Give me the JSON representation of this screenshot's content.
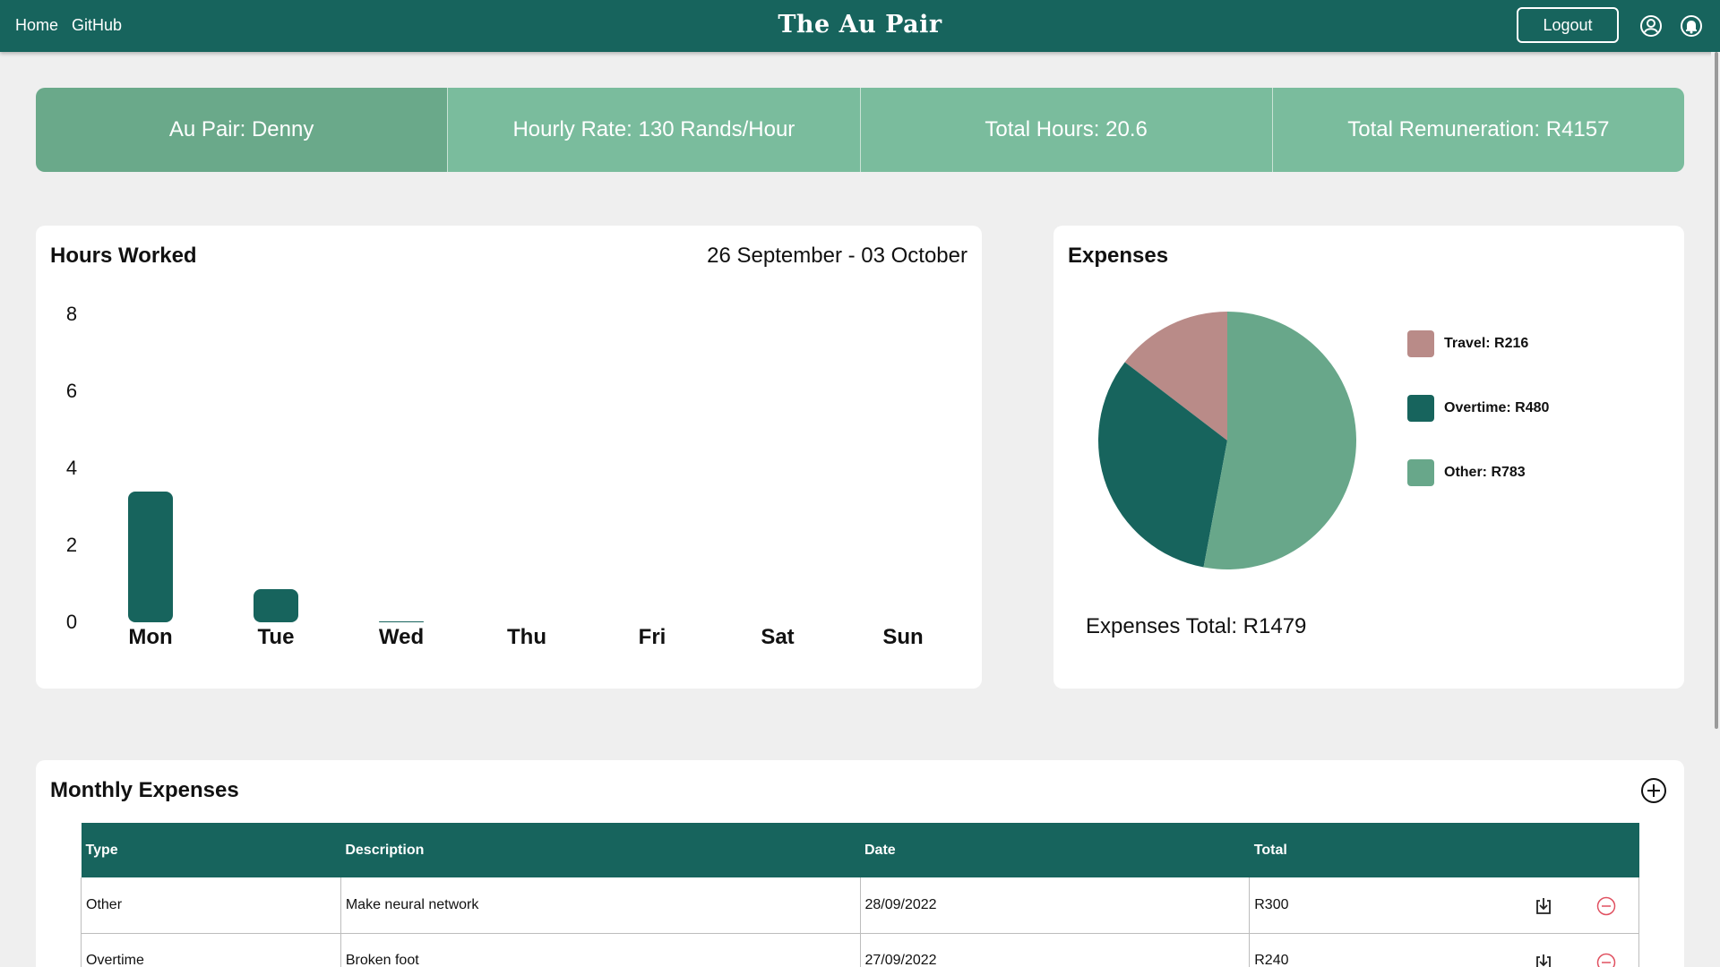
{
  "nav": {
    "home": "Home",
    "github": "GitHub",
    "brand": "The Au Pair",
    "logout": "Logout",
    "profile_icon": "user-circle-icon",
    "bell_icon": "notification-bell-icon"
  },
  "stats": {
    "au_pair": "Au Pair: Denny",
    "hourly_rate": "Hourly Rate: 130 Rands/Hour",
    "total_hours": "Total Hours: 20.6",
    "total_remuneration": "Total Remuneration: R4157"
  },
  "hours_card": {
    "title": "Hours Worked",
    "range": "26 September - 03 October"
  },
  "expenses_card": {
    "title": "Expenses",
    "total": "Expenses Total: R1479"
  },
  "chart_data": [
    {
      "type": "bar",
      "title": "Hours Worked",
      "categories": [
        "Mon",
        "Tue",
        "Wed",
        "Thu",
        "Fri",
        "Sat",
        "Sun"
      ],
      "values": [
        3.4,
        0.85,
        0.03,
        0,
        0,
        0,
        0
      ],
      "yticks": [
        "0",
        "2",
        "4",
        "6",
        "8"
      ],
      "ylim": [
        0,
        8
      ],
      "grid": false,
      "bar_color": "#17645d"
    },
    {
      "type": "pie",
      "title": "Expenses",
      "labels": [
        "Travel: R216",
        "Overtime: R480",
        "Other: R783"
      ],
      "values": [
        216,
        480,
        783
      ],
      "colors": [
        "#b98b88",
        "#17645d",
        "#68a78a"
      ],
      "legend": "right"
    }
  ],
  "monthly": {
    "title": "Monthly Expenses",
    "add_icon": "plus-circle-icon",
    "columns": [
      "Type",
      "Description",
      "Date",
      "Total"
    ],
    "rows": [
      {
        "type": "Other",
        "description": "Make neural network",
        "date": "28/09/2022",
        "total": "R300"
      },
      {
        "type": "Overtime",
        "description": "Broken foot",
        "date": "27/09/2022",
        "total": "R240"
      }
    ],
    "row_icons": {
      "download": "download-icon",
      "remove": "remove-circle-icon"
    }
  },
  "colors": {
    "primary": "#17645d",
    "stat_bg": "#7abc9d",
    "stat_active": "#6aa98a",
    "danger": "#e05060",
    "page_bg": "#efefef"
  }
}
